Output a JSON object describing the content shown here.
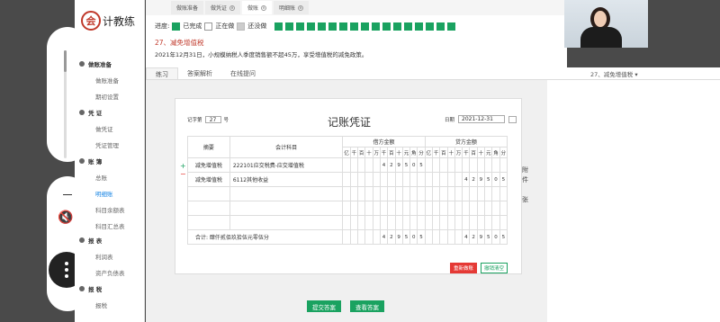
{
  "logo": {
    "mark": "会",
    "text": "计教练"
  },
  "top_tabs": [
    {
      "label": "做账准备",
      "closable": false
    },
    {
      "label": "做凭证",
      "closable": true
    },
    {
      "label": "做账",
      "closable": true,
      "active": true
    },
    {
      "label": "明细账",
      "closable": true
    }
  ],
  "progress": {
    "label": "进度:",
    "done": "已完成",
    "doing": "正在做",
    "not_done": "还没做",
    "done_count": 17
  },
  "question": {
    "title": "27、减免增值税",
    "desc": "2021年12月31日，小规模纳税人季度销售额不超45万，享受增值税的减免政策。"
  },
  "subtabs": [
    "练习",
    "答案解析",
    "在线提问"
  ],
  "question_select": "27、减免增值税",
  "sidebar": {
    "groups": [
      {
        "title": "做账准备",
        "items": [
          "做账准备",
          "期初设置"
        ]
      },
      {
        "title": "凭 证",
        "items": [
          "做凭证",
          "凭证管理"
        ]
      },
      {
        "title": "账 簿",
        "items": [
          "总账",
          "明细账",
          "科目余额表",
          "科目汇总表"
        ]
      },
      {
        "title": "报 表",
        "items": [
          "利润表",
          "资产负债表"
        ]
      },
      {
        "title": "报 税",
        "items": [
          "报税"
        ]
      }
    ],
    "active_item": "明细账"
  },
  "voucher": {
    "title": "记账凭证",
    "no_label": "记字第",
    "no_value": "27",
    "no_suffix": "号",
    "date_label": "日期",
    "date_value": "2021-12-31",
    "headers": {
      "summary": "摘要",
      "account": "会计科目",
      "debit": "借方金额",
      "credit": "贷方金额"
    },
    "digits": [
      "亿",
      "千",
      "百",
      "十",
      "万",
      "千",
      "百",
      "十",
      "元",
      "角",
      "分"
    ],
    "rows": [
      {
        "summary": "减免增值税",
        "account": "222101应交税费-应交增值税",
        "debit": "429505",
        "credit": ""
      },
      {
        "summary": "减免增值税",
        "account": "6112其他收益",
        "debit": "",
        "credit": "429505"
      }
    ],
    "total_label": "合计: 肆仟贰佰玖拾伍元零伍分",
    "total_debit": "429505",
    "total_credit": "429505",
    "reset_btn": "重新做账",
    "clear_btn": "撤销清空",
    "side_text": "附件\n张"
  },
  "buttons": {
    "submit": "提交答案",
    "view": "查看答案"
  }
}
